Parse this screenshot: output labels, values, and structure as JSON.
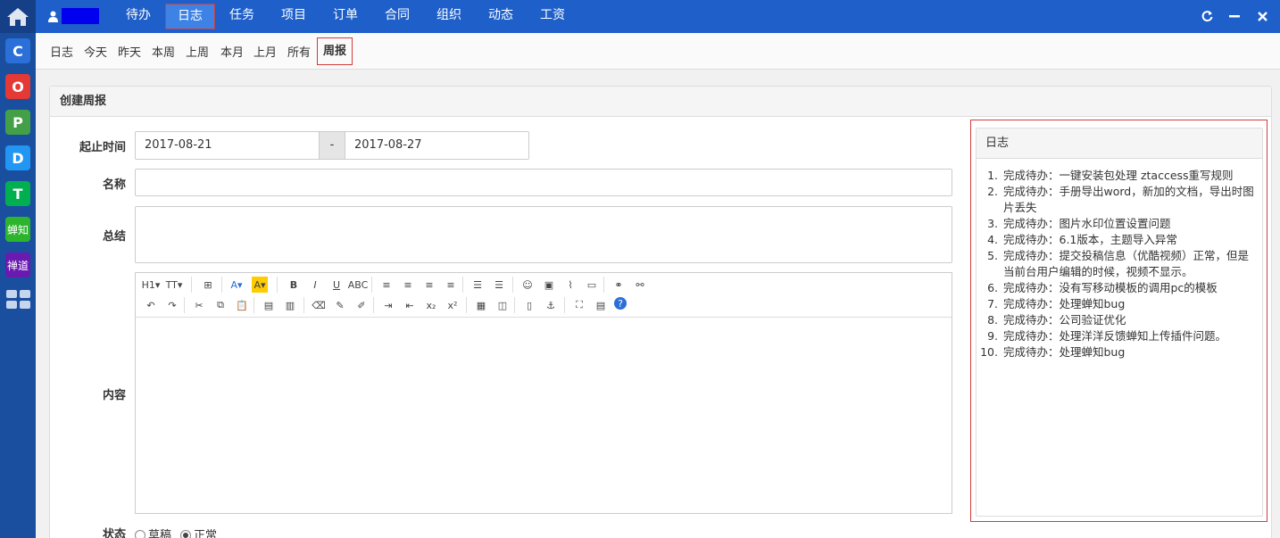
{
  "nav": {
    "items": [
      "待办",
      "日志",
      "任务",
      "项目",
      "订单",
      "合同",
      "组织",
      "动态",
      "工资"
    ],
    "active": "日志",
    "user_name": ""
  },
  "apps": [
    {
      "letter": "C",
      "color": "#2b6fd8"
    },
    {
      "letter": "O",
      "color": "#e53935"
    },
    {
      "letter": "P",
      "color": "#43a047"
    },
    {
      "letter": "D",
      "color": "#2196f3"
    },
    {
      "letter": "T",
      "color": "#00b050"
    },
    {
      "letter": "蝉知",
      "color": "#2cb52c"
    },
    {
      "letter": "禅道",
      "color": "#6a1ab0"
    }
  ],
  "subnav": {
    "items": [
      "日志",
      "今天",
      "昨天",
      "本周",
      "上周",
      "本月",
      "上月",
      "所有",
      "周报"
    ],
    "active": "周报"
  },
  "panel": {
    "title": "创建周报",
    "labels": {
      "date_range": "起止时间",
      "name": "名称",
      "summary": "总结",
      "content": "内容",
      "status": "状态"
    },
    "start_date": "2017-08-21",
    "date_sep": "-",
    "end_date": "2017-08-27",
    "status_options": [
      "草稿",
      "正常"
    ],
    "status_selected": "正常"
  },
  "editor": {
    "row1": [
      "H1",
      "TT",
      "grid",
      "font-color",
      "highlight",
      "B",
      "I",
      "U",
      "ABC",
      "align-left",
      "align-center",
      "align-right",
      "justify",
      "ol",
      "ul",
      "emoji",
      "image",
      "attach",
      "insert",
      "link",
      "unlink"
    ],
    "row2": [
      "undo",
      "redo",
      "cut",
      "copy",
      "paste",
      "paste-text",
      "paste-word",
      "eraser",
      "brush",
      "format",
      "indent",
      "outdent",
      "sub",
      "sup",
      "table",
      "code",
      "page",
      "anchor",
      "fullscreen",
      "source",
      "help"
    ]
  },
  "log": {
    "title": "日志",
    "items": [
      "完成待办：一键安装包处理 ztaccess重写规则",
      "完成待办：手册导出word，新加的文档，导出时图片丢失",
      "完成待办：图片水印位置设置问题",
      "完成待办：6.1版本，主题导入异常",
      "完成待办：提交投稿信息（优酷视频）正常，但是当前台用户编辑的时候，视频不显示。",
      "完成待办：没有写移动模板的调用pc的模板",
      "完成待办：处理蝉知bug",
      "完成待办：公司验证优化",
      "完成待办：处理洋洋反馈蝉知上传插件问题。",
      "完成待办：处理蝉知bug"
    ]
  }
}
